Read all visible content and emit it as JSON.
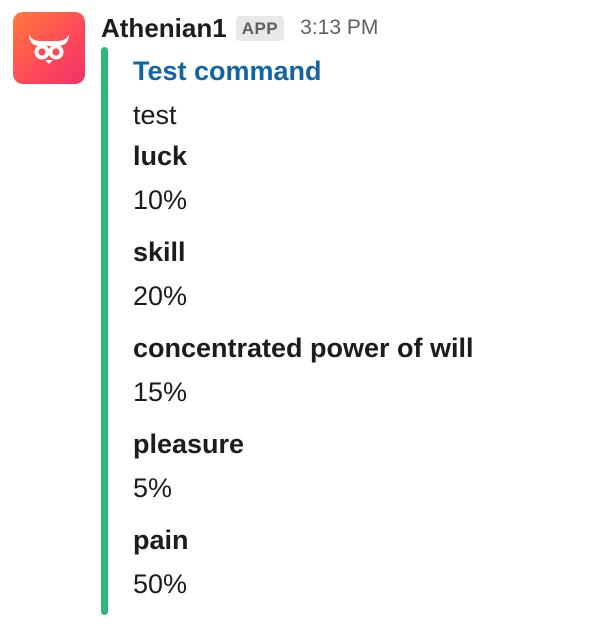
{
  "message": {
    "sender": "Athenian1",
    "badge": "APP",
    "timestamp": "3:13 PM",
    "avatar_icon": "owl-bull-logo-icon"
  },
  "attachment": {
    "accent_color": "#2eb67d",
    "title": "Test command",
    "text": "test",
    "fields": [
      {
        "title": "luck",
        "value": "10%"
      },
      {
        "title": "skill",
        "value": "20%"
      },
      {
        "title": "concentrated power of will",
        "value": "15%"
      },
      {
        "title": "pleasure",
        "value": "5%"
      },
      {
        "title": "pain",
        "value": "50%"
      }
    ]
  }
}
